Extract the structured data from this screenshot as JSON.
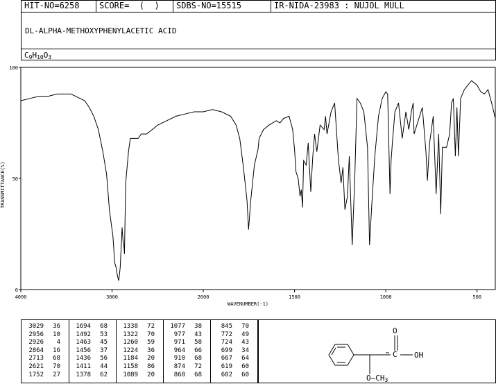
{
  "header": {
    "hit": "HIT-NO=6258",
    "score": "SCORE=  (  )",
    "sdbs": "SDBS-NO=15515",
    "irnida": "IR-NIDA-23983 : NUJOL MULL"
  },
  "compound_name": "DL-ALPHA-METHOXYPHENYLACETIC ACID",
  "formula": {
    "c": "C",
    "c_n": "9",
    "h": "H",
    "h_n": "10",
    "o": "O",
    "o_n": "3"
  },
  "chart_data": {
    "type": "line",
    "xlabel": "WAVENUMBER(-1)",
    "ylabel": "TRANSMITTANCE(%)",
    "xlim": [
      4000,
      400
    ],
    "ylim": [
      0,
      100
    ],
    "x_ticks": [
      4000,
      3000,
      2000,
      1500,
      1000,
      500
    ],
    "y_ticks": [
      0,
      50,
      100
    ],
    "series": [
      {
        "x": [
          4000,
          3900,
          3800,
          3700,
          3600,
          3500,
          3450,
          3400,
          3350,
          3300,
          3250,
          3200,
          3150,
          3100,
          3060,
          3029,
          3010,
          2990,
          2970,
          2956,
          2940,
          2926,
          2910,
          2890,
          2880,
          2870,
          2864,
          2850,
          2820,
          2800,
          2760,
          2713,
          2680,
          2621,
          2560,
          2500,
          2400,
          2300,
          2200,
          2100,
          2000,
          1950,
          1900,
          1850,
          1820,
          1800,
          1780,
          1760,
          1752,
          1740,
          1720,
          1700,
          1694,
          1670,
          1640,
          1600,
          1580,
          1560,
          1530,
          1510,
          1500,
          1492,
          1480,
          1470,
          1463,
          1456,
          1450,
          1436,
          1425,
          1411,
          1400,
          1390,
          1378,
          1360,
          1338,
          1330,
          1322,
          1300,
          1280,
          1260,
          1245,
          1235,
          1224,
          1210,
          1200,
          1184,
          1170,
          1158,
          1140,
          1120,
          1100,
          1089,
          1077,
          1060,
          1040,
          1020,
          1000,
          990,
          977,
          971,
          964,
          950,
          930,
          910,
          890,
          874,
          860,
          850,
          845,
          830,
          800,
          780,
          772,
          760,
          740,
          724,
          710,
          699,
          690,
          667,
          650,
          640,
          630,
          619,
          610,
          602,
          590,
          570,
          550,
          530,
          500,
          480,
          460,
          440,
          420,
          400
        ],
        "y": [
          85,
          86,
          87,
          87,
          88,
          88,
          88,
          87,
          86,
          85,
          82,
          78,
          72,
          62,
          52,
          36,
          30,
          24,
          12,
          10,
          6,
          4,
          10,
          28,
          22,
          20,
          16,
          48,
          62,
          68,
          68,
          68,
          70,
          70,
          72,
          74,
          76,
          78,
          79,
          80,
          80,
          81,
          80,
          78,
          74,
          68,
          55,
          40,
          27,
          40,
          56,
          63,
          68,
          72,
          74,
          76,
          75,
          77,
          78,
          72,
          63,
          53,
          50,
          42,
          45,
          37,
          58,
          56,
          66,
          44,
          60,
          70,
          62,
          74,
          72,
          78,
          70,
          80,
          84,
          59,
          48,
          55,
          36,
          42,
          60,
          20,
          50,
          86,
          84,
          80,
          64,
          20,
          38,
          60,
          78,
          86,
          89,
          88,
          43,
          58,
          66,
          80,
          84,
          68,
          80,
          72,
          80,
          84,
          70,
          74,
          82,
          62,
          49,
          66,
          78,
          43,
          70,
          34,
          64,
          64,
          70,
          84,
          86,
          60,
          82,
          60,
          86,
          90,
          92,
          94,
          92,
          89,
          88,
          90,
          84,
          77
        ]
      }
    ]
  },
  "peaks": [
    {
      "wn": "3029",
      "t": "36"
    },
    {
      "wn": "2956",
      "t": "10"
    },
    {
      "wn": "2926",
      "t": "4"
    },
    {
      "wn": "2864",
      "t": "16"
    },
    {
      "wn": "2713",
      "t": "68"
    },
    {
      "wn": "2621",
      "t": "70"
    },
    {
      "wn": "1752",
      "t": "27"
    },
    {
      "wn": "1694",
      "t": "68"
    },
    {
      "wn": "1492",
      "t": "53"
    },
    {
      "wn": "1463",
      "t": "45"
    },
    {
      "wn": "1456",
      "t": "37"
    },
    {
      "wn": "1436",
      "t": "56"
    },
    {
      "wn": "1411",
      "t": "44"
    },
    {
      "wn": "1378",
      "t": "62"
    },
    {
      "wn": "1338",
      "t": "72"
    },
    {
      "wn": "1322",
      "t": "70"
    },
    {
      "wn": "1260",
      "t": "59"
    },
    {
      "wn": "1224",
      "t": "36"
    },
    {
      "wn": "1184",
      "t": "20"
    },
    {
      "wn": "1158",
      "t": "86"
    },
    {
      "wn": "1089",
      "t": "20"
    },
    {
      "wn": "1077",
      "t": "38"
    },
    {
      "wn": "977",
      "t": "43"
    },
    {
      "wn": "971",
      "t": "58"
    },
    {
      "wn": "964",
      "t": "66"
    },
    {
      "wn": "910",
      "t": "68"
    },
    {
      "wn": "874",
      "t": "72"
    },
    {
      "wn": "868",
      "t": "68"
    },
    {
      "wn": "845",
      "t": "70"
    },
    {
      "wn": "772",
      "t": "49"
    },
    {
      "wn": "724",
      "t": "43"
    },
    {
      "wn": "699",
      "t": "34"
    },
    {
      "wn": "667",
      "t": "64"
    },
    {
      "wn": "619",
      "t": "60"
    },
    {
      "wn": "602",
      "t": "60"
    }
  ],
  "structure": {
    "o_label": "O",
    "oh_label": "OH",
    "ome_label": "O—CH",
    "ome_sub": "3"
  }
}
